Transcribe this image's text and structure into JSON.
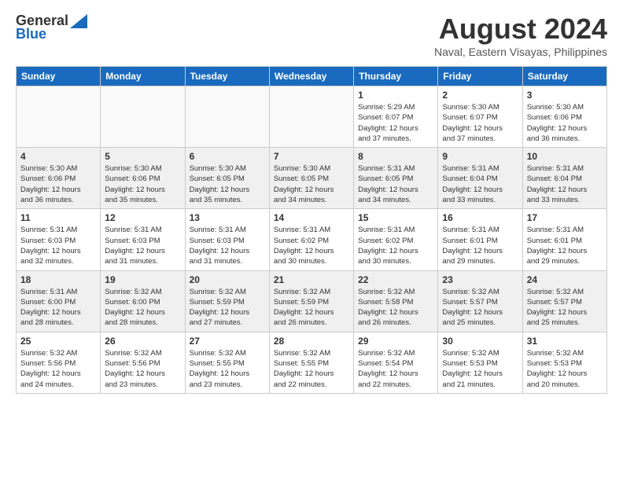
{
  "header": {
    "logo_general": "General",
    "logo_blue": "Blue",
    "month_year": "August 2024",
    "location": "Naval, Eastern Visayas, Philippines"
  },
  "weekdays": [
    "Sunday",
    "Monday",
    "Tuesday",
    "Wednesday",
    "Thursday",
    "Friday",
    "Saturday"
  ],
  "weeks": [
    [
      {
        "day": "",
        "info": "",
        "empty": true
      },
      {
        "day": "",
        "info": "",
        "empty": true
      },
      {
        "day": "",
        "info": "",
        "empty": true
      },
      {
        "day": "",
        "info": "",
        "empty": true
      },
      {
        "day": "1",
        "info": "Sunrise: 5:29 AM\nSunset: 6:07 PM\nDaylight: 12 hours\nand 37 minutes."
      },
      {
        "day": "2",
        "info": "Sunrise: 5:30 AM\nSunset: 6:07 PM\nDaylight: 12 hours\nand 37 minutes."
      },
      {
        "day": "3",
        "info": "Sunrise: 5:30 AM\nSunset: 6:06 PM\nDaylight: 12 hours\nand 36 minutes."
      }
    ],
    [
      {
        "day": "4",
        "info": "Sunrise: 5:30 AM\nSunset: 6:06 PM\nDaylight: 12 hours\nand 36 minutes."
      },
      {
        "day": "5",
        "info": "Sunrise: 5:30 AM\nSunset: 6:06 PM\nDaylight: 12 hours\nand 35 minutes."
      },
      {
        "day": "6",
        "info": "Sunrise: 5:30 AM\nSunset: 6:05 PM\nDaylight: 12 hours\nand 35 minutes."
      },
      {
        "day": "7",
        "info": "Sunrise: 5:30 AM\nSunset: 6:05 PM\nDaylight: 12 hours\nand 34 minutes."
      },
      {
        "day": "8",
        "info": "Sunrise: 5:31 AM\nSunset: 6:05 PM\nDaylight: 12 hours\nand 34 minutes."
      },
      {
        "day": "9",
        "info": "Sunrise: 5:31 AM\nSunset: 6:04 PM\nDaylight: 12 hours\nand 33 minutes."
      },
      {
        "day": "10",
        "info": "Sunrise: 5:31 AM\nSunset: 6:04 PM\nDaylight: 12 hours\nand 33 minutes."
      }
    ],
    [
      {
        "day": "11",
        "info": "Sunrise: 5:31 AM\nSunset: 6:03 PM\nDaylight: 12 hours\nand 32 minutes."
      },
      {
        "day": "12",
        "info": "Sunrise: 5:31 AM\nSunset: 6:03 PM\nDaylight: 12 hours\nand 31 minutes."
      },
      {
        "day": "13",
        "info": "Sunrise: 5:31 AM\nSunset: 6:03 PM\nDaylight: 12 hours\nand 31 minutes."
      },
      {
        "day": "14",
        "info": "Sunrise: 5:31 AM\nSunset: 6:02 PM\nDaylight: 12 hours\nand 30 minutes."
      },
      {
        "day": "15",
        "info": "Sunrise: 5:31 AM\nSunset: 6:02 PM\nDaylight: 12 hours\nand 30 minutes."
      },
      {
        "day": "16",
        "info": "Sunrise: 5:31 AM\nSunset: 6:01 PM\nDaylight: 12 hours\nand 29 minutes."
      },
      {
        "day": "17",
        "info": "Sunrise: 5:31 AM\nSunset: 6:01 PM\nDaylight: 12 hours\nand 29 minutes."
      }
    ],
    [
      {
        "day": "18",
        "info": "Sunrise: 5:31 AM\nSunset: 6:00 PM\nDaylight: 12 hours\nand 28 minutes."
      },
      {
        "day": "19",
        "info": "Sunrise: 5:32 AM\nSunset: 6:00 PM\nDaylight: 12 hours\nand 28 minutes."
      },
      {
        "day": "20",
        "info": "Sunrise: 5:32 AM\nSunset: 5:59 PM\nDaylight: 12 hours\nand 27 minutes."
      },
      {
        "day": "21",
        "info": "Sunrise: 5:32 AM\nSunset: 5:59 PM\nDaylight: 12 hours\nand 26 minutes."
      },
      {
        "day": "22",
        "info": "Sunrise: 5:32 AM\nSunset: 5:58 PM\nDaylight: 12 hours\nand 26 minutes."
      },
      {
        "day": "23",
        "info": "Sunrise: 5:32 AM\nSunset: 5:57 PM\nDaylight: 12 hours\nand 25 minutes."
      },
      {
        "day": "24",
        "info": "Sunrise: 5:32 AM\nSunset: 5:57 PM\nDaylight: 12 hours\nand 25 minutes."
      }
    ],
    [
      {
        "day": "25",
        "info": "Sunrise: 5:32 AM\nSunset: 5:56 PM\nDaylight: 12 hours\nand 24 minutes."
      },
      {
        "day": "26",
        "info": "Sunrise: 5:32 AM\nSunset: 5:56 PM\nDaylight: 12 hours\nand 23 minutes."
      },
      {
        "day": "27",
        "info": "Sunrise: 5:32 AM\nSunset: 5:55 PM\nDaylight: 12 hours\nand 23 minutes."
      },
      {
        "day": "28",
        "info": "Sunrise: 5:32 AM\nSunset: 5:55 PM\nDaylight: 12 hours\nand 22 minutes."
      },
      {
        "day": "29",
        "info": "Sunrise: 5:32 AM\nSunset: 5:54 PM\nDaylight: 12 hours\nand 22 minutes."
      },
      {
        "day": "30",
        "info": "Sunrise: 5:32 AM\nSunset: 5:53 PM\nDaylight: 12 hours\nand 21 minutes."
      },
      {
        "day": "31",
        "info": "Sunrise: 5:32 AM\nSunset: 5:53 PM\nDaylight: 12 hours\nand 20 minutes."
      }
    ]
  ]
}
